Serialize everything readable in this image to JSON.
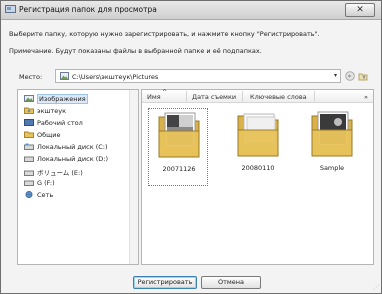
{
  "window": {
    "title": "Регистрация папок для просмотра",
    "close_glyph": "✕"
  },
  "instructions": {
    "line1": "Выберите папку, которую нужно зарегистрировать, и нажмите кнопку \"Регистрировать\".",
    "line2": "Примечание. Будут показаны файлы в выбранной папке и её подпапках."
  },
  "location": {
    "label": "Место:",
    "value": "C:\\Users\\экштеук\\Pictures",
    "dropdown_glyph": "▾",
    "back_icon": "back-arrow-icon",
    "up_icon": "up-folder-icon"
  },
  "tree": {
    "items": [
      {
        "label": "Изображения",
        "icon": "pictures-folder-icon",
        "selected": true
      },
      {
        "label": "экштеук",
        "icon": "user-folder-icon"
      },
      {
        "label": "Рабочий стол",
        "icon": "desktop-icon"
      },
      {
        "label": "Общие",
        "icon": "public-folder-icon"
      },
      {
        "label": "Локальный диск (C:)",
        "icon": "drive-icon"
      },
      {
        "label": "Локальный диск (D:)",
        "icon": "drive-icon"
      },
      {
        "label": "ボリューム (E:)",
        "icon": "drive-icon"
      },
      {
        "label": "G (F:)",
        "icon": "drive-icon"
      },
      {
        "label": "Сеть",
        "icon": "network-icon"
      }
    ]
  },
  "files": {
    "columns": [
      "Имя",
      "Дата съемки",
      "Ключевые слова"
    ],
    "more_glyph": "»",
    "sort_glyph": "^",
    "items": [
      {
        "name": "20071126",
        "selected": true,
        "has_photo": true
      },
      {
        "name": "20080110",
        "selected": false,
        "has_photo": false
      },
      {
        "name": "Sample",
        "selected": false,
        "has_photo": true
      }
    ]
  },
  "buttons": {
    "register": "Регистрировать",
    "cancel": "Отмена"
  },
  "colors": {
    "folder": "#e8c35a",
    "selection": "#dce9f8",
    "accent": "#3c7fb1"
  }
}
